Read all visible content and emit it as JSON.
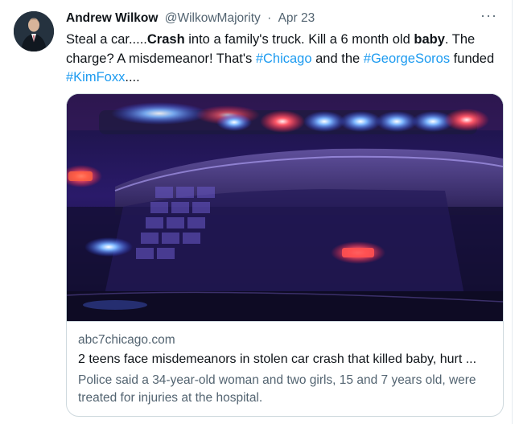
{
  "tweet": {
    "author_name": "Andrew Wilkow",
    "author_handle": "@WilkowMajority",
    "separator": "·",
    "date": "Apr 23",
    "more_label": "···",
    "text": {
      "p1": "Steal a car.....",
      "p2": "Crash",
      "p3": " into a family's truck. Kill a 6 month old ",
      "p4": "baby",
      "p5": ". The charge? A misdemeanor! That's ",
      "tag1": "#Chicago",
      "p6": " and the ",
      "tag2": "#GeorgeSoros",
      "p7": " funded ",
      "tag3": "#KimFoxx",
      "p8": "...."
    }
  },
  "card": {
    "domain": "abc7chicago.com",
    "headline": "2 teens face misdemeanors in stolen car crash that killed baby, hurt ...",
    "description": "Police said a 34-year-old woman and two girls, 15 and 7 years old, were treated for injuries at the hospital."
  },
  "colors": {
    "link": "#1d9bf0",
    "text": "#0f1419",
    "muted": "#536471",
    "border": "#cfd9de"
  }
}
